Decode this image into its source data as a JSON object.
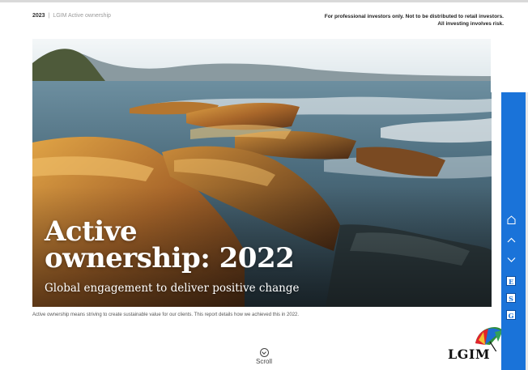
{
  "header": {
    "year": "2023",
    "separator": "|",
    "section": "LGIM Active ownership",
    "disclaimer": "For professional investors only. Not to be distributed to retail investors. All investing involves risk."
  },
  "hero": {
    "title_line1": "Active",
    "title_line2": "ownership: 2022",
    "subtitle": "Global engagement to deliver positive change"
  },
  "intro": "Active ownership means striving to create sustainable value for our clients. This report details how we achieved this in 2022.",
  "scroll": {
    "label": "Scroll",
    "icon": "chevron-down-circle-icon"
  },
  "logo": {
    "text": "LGIM",
    "icon": "umbrella-logo"
  },
  "sidebar": {
    "background": "#1a73d9",
    "nav": [
      {
        "name": "home",
        "icon": "home-icon"
      },
      {
        "name": "previous",
        "icon": "chevron-up-icon"
      },
      {
        "name": "next",
        "icon": "chevron-down-icon"
      }
    ],
    "letters": [
      "E",
      "S",
      "G"
    ]
  }
}
